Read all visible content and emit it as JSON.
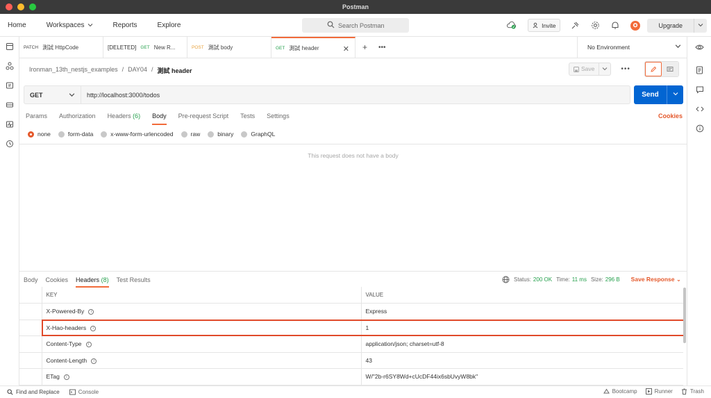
{
  "window": {
    "title": "Postman"
  },
  "header": {
    "nav": [
      "Home",
      "Workspaces",
      "Reports",
      "Explore"
    ],
    "search_placeholder": "Search Postman",
    "invite_label": "Invite",
    "upgrade_label": "Upgrade"
  },
  "tabs": [
    {
      "method": "PATCH",
      "method_color": "#7b61c9",
      "name": "測試 HttpCode",
      "active": false
    },
    {
      "method": "[DELETED]",
      "method_color": "#333333",
      "extra": "GET",
      "name": "New R...",
      "active": false
    },
    {
      "method": "POST",
      "method_color": "#e8a13c",
      "name": "測試 body",
      "active": false
    },
    {
      "method": "GET",
      "method_color": "#26a04d",
      "name": "測試 header",
      "active": true
    }
  ],
  "environment": "No Environment",
  "breadcrumb": [
    "Ironman_13th_nestjs_examples",
    "DAY04",
    "測試 header"
  ],
  "save_label": "Save",
  "request": {
    "method": "GET",
    "url": "http://localhost:3000/todos",
    "send_label": "Send",
    "tabs": [
      "Params",
      "Authorization",
      "Headers",
      "Body",
      "Pre-request Script",
      "Tests",
      "Settings"
    ],
    "headers_count": "(6)",
    "active_tab": "Body",
    "cookies_label": "Cookies",
    "body_types": [
      "none",
      "form-data",
      "x-www-form-urlencoded",
      "raw",
      "binary",
      "GraphQL"
    ],
    "selected_body_type": "none",
    "no_body_text": "This request does not have a body"
  },
  "response": {
    "tabs": [
      "Body",
      "Cookies",
      "Headers",
      "Test Results"
    ],
    "headers_count": "(8)",
    "active_tab": "Headers",
    "status_label": "Status:",
    "status": "200 OK",
    "time_label": "Time:",
    "time": "11 ms",
    "size_label": "Size:",
    "size": "296 B",
    "save_response_label": "Save Response",
    "columns": [
      "KEY",
      "VALUE"
    ],
    "headers": [
      {
        "key": "X-Powered-By",
        "value": "Express"
      },
      {
        "key": "X-Hao-headers",
        "value": "1"
      },
      {
        "key": "Content-Type",
        "value": "application/json; charset=utf-8"
      },
      {
        "key": "Content-Length",
        "value": "43"
      },
      {
        "key": "ETag",
        "value": "W/\"2b-r6SY8Wd+cUcDF44ix6sbUvyW8bk\""
      }
    ]
  },
  "footer": {
    "find_replace": "Find and Replace",
    "console": "Console",
    "bootcamp": "Bootcamp",
    "runner": "Runner",
    "trash": "Trash"
  },
  "colors": {
    "accent": "#f26b3a",
    "send": "#0265d2",
    "status_ok": "#26a04d",
    "highlight": "#e04a2a"
  }
}
